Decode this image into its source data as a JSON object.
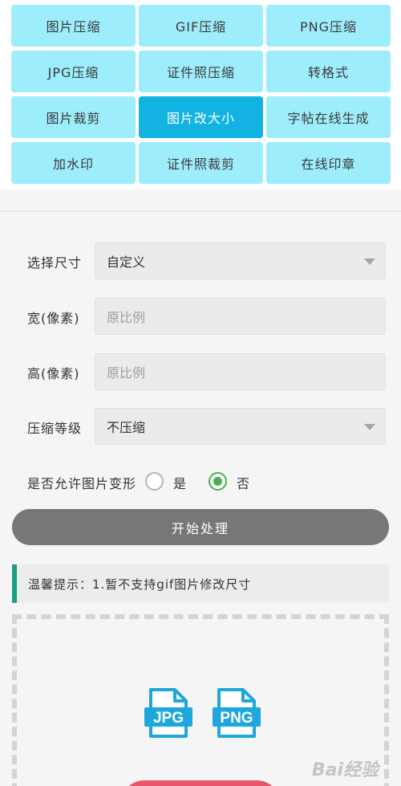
{
  "tools": [
    {
      "label": "图片压缩",
      "active": false
    },
    {
      "label": "GIF压缩",
      "active": false
    },
    {
      "label": "PNG压缩",
      "active": false
    },
    {
      "label": "JPG压缩",
      "active": false
    },
    {
      "label": "证件照压缩",
      "active": false
    },
    {
      "label": "转格式",
      "active": false
    },
    {
      "label": "图片裁剪",
      "active": false
    },
    {
      "label": "图片改大小",
      "active": true
    },
    {
      "label": "字帖在线生成",
      "active": false
    },
    {
      "label": "加水印",
      "active": false
    },
    {
      "label": "证件照裁剪",
      "active": false
    },
    {
      "label": "在线印章",
      "active": false
    }
  ],
  "form": {
    "size": {
      "label": "选择尺寸",
      "value": "自定义"
    },
    "width": {
      "label": "宽(像素)",
      "placeholder": "原比例"
    },
    "height": {
      "label": "高(像素)",
      "placeholder": "原比例"
    },
    "compression": {
      "label": "压缩等级",
      "value": "不压缩"
    },
    "deform": {
      "label": "是否允许图片变形",
      "yes": "是",
      "no": "否",
      "selected": "否"
    }
  },
  "start_button": "开始处理",
  "tip": "温馨提示：1.暂不支持gif图片修改尺寸",
  "file_icons": [
    "JPG",
    "PNG"
  ],
  "colors": {
    "accent": "#12b3e3",
    "tile": "#9eedfc",
    "tip_bar": "#1aa083",
    "radio_checked": "#4caf50",
    "icon_blue": "#1da7dd"
  },
  "watermark": "Bai经验"
}
